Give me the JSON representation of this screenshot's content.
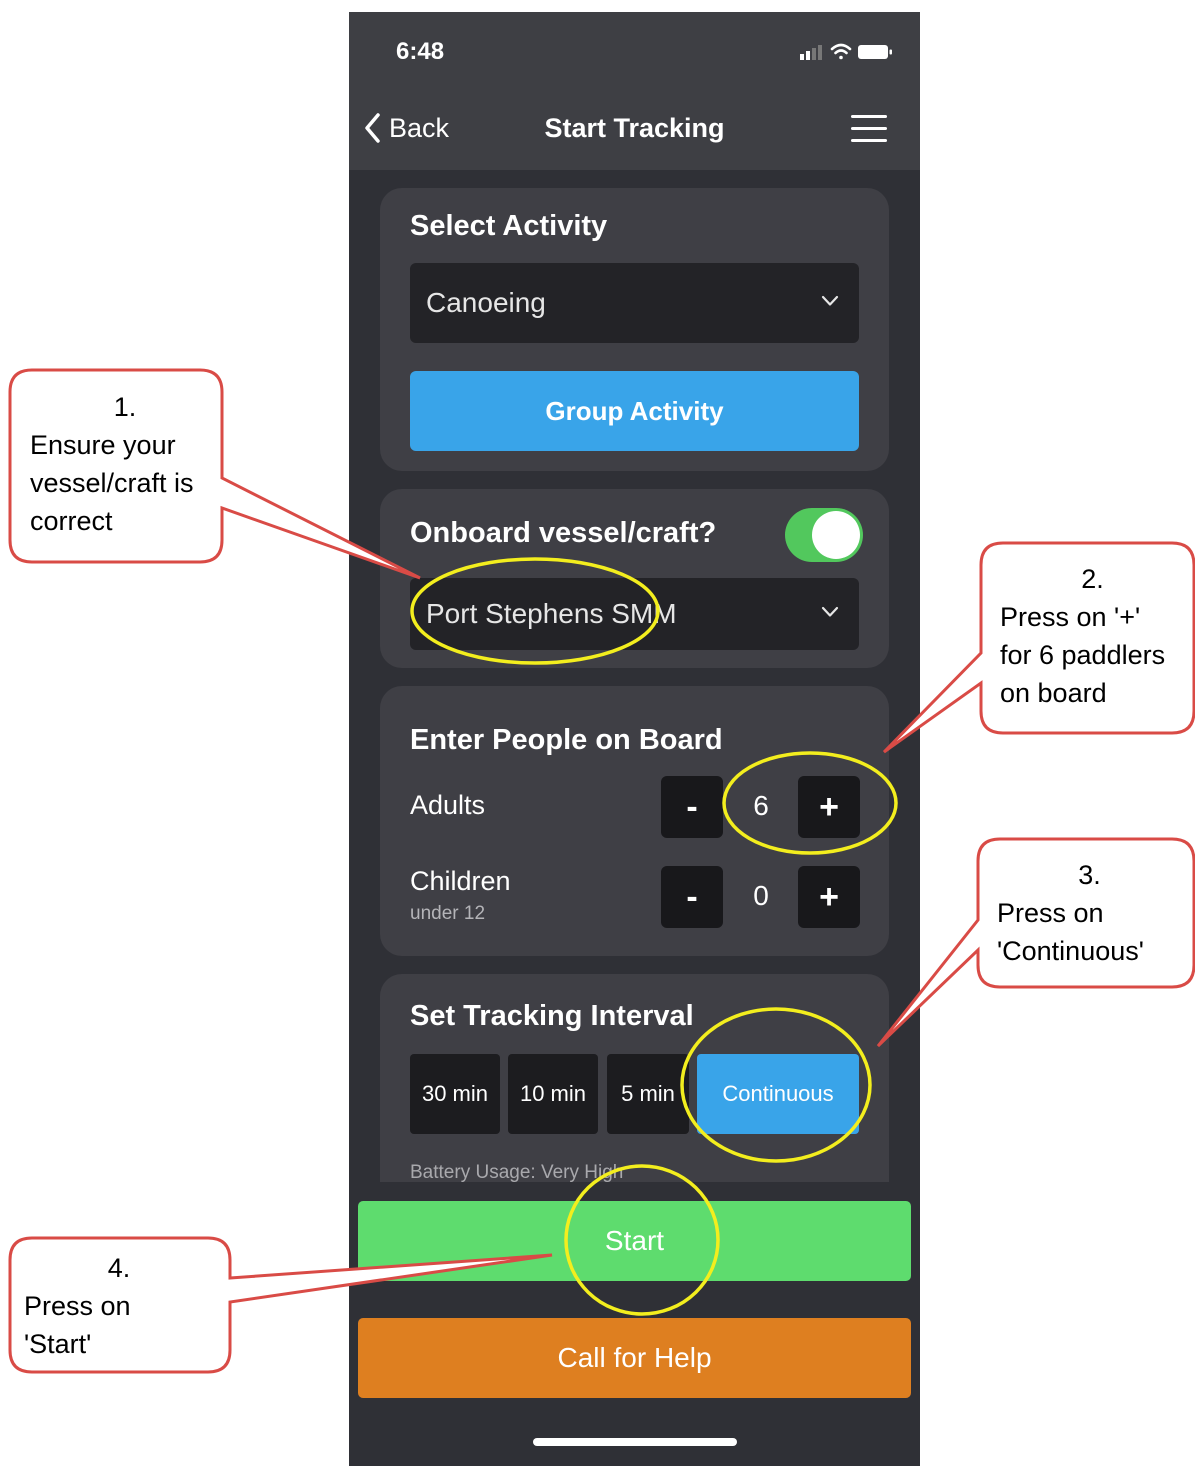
{
  "status_bar": {
    "time": "6:48"
  },
  "nav": {
    "back_label": "Back",
    "title": "Start Tracking"
  },
  "activity": {
    "title": "Select Activity",
    "selected": "Canoeing",
    "group_button": "Group Activity"
  },
  "vessel": {
    "title": "Onboard vessel/craft?",
    "toggle_on": true,
    "selected": "Port Stephens SMM"
  },
  "people": {
    "title": "Enter People on Board",
    "adults": {
      "label": "Adults",
      "value": "6",
      "minus": "-",
      "plus": "+"
    },
    "children": {
      "label": "Children",
      "sublabel": "under 12",
      "value": "0",
      "minus": "-",
      "plus": "+"
    }
  },
  "interval": {
    "title": "Set Tracking Interval",
    "options": [
      "30 min",
      "10 min",
      "5 min",
      "Continuous"
    ],
    "selected": "Continuous",
    "battery_text": "Battery Usage: Very High"
  },
  "actions": {
    "start": "Start",
    "help": "Call for Help"
  },
  "callouts": [
    {
      "number": "1.",
      "lines": [
        "Ensure your",
        "vessel/craft is",
        "correct"
      ]
    },
    {
      "number": "2.",
      "lines": [
        "Press on '+'",
        "for 6 paddlers",
        "on board"
      ]
    },
    {
      "number": "3.",
      "lines": [
        "Press on",
        "'Continuous'"
      ]
    },
    {
      "number": "4.",
      "lines": [
        "Press on",
        "'Start'"
      ]
    }
  ],
  "colors": {
    "accent_blue": "#39a4e9",
    "start_green": "#5edc6e",
    "help_orange": "#de7f20",
    "toggle_green": "#52c85d",
    "highlight_yellow": "#f3ee1e",
    "callout_border": "#d94b46"
  }
}
